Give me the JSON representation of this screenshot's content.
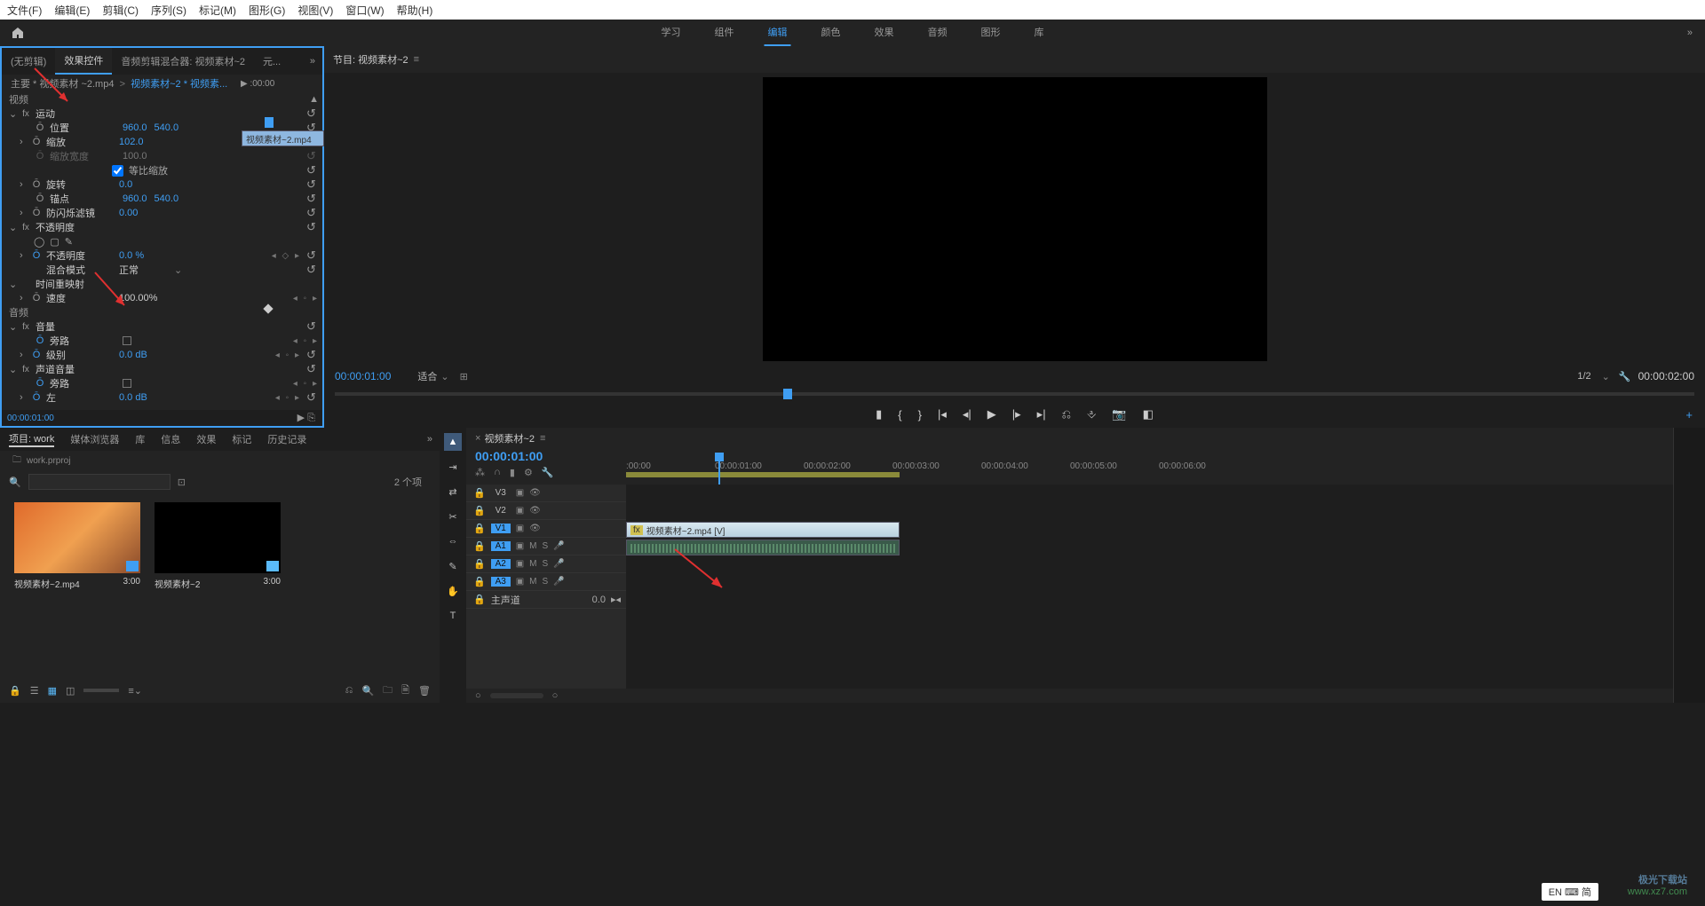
{
  "menubar": {
    "items": [
      "文件(F)",
      "编辑(E)",
      "剪辑(C)",
      "序列(S)",
      "标记(M)",
      "图形(G)",
      "视图(V)",
      "窗口(W)",
      "帮助(H)"
    ]
  },
  "workspace": {
    "tabs": [
      "学习",
      "组件",
      "编辑",
      "颜色",
      "效果",
      "音频",
      "图形",
      "库"
    ],
    "active_index": 2
  },
  "source_tabs": {
    "items": [
      "(无剪辑)",
      "效果控件",
      "音频剪辑混合器: 视频素材~2",
      "元..."
    ],
    "active_index": 1
  },
  "effect_header": {
    "master": "主要 * 视频素材 ~2.mp4",
    "sequence": "视频素材~2 * 视频素...",
    "time_start": ":00:00",
    "time_end": "00:00",
    "clip_label": "视频素材~2.mp4"
  },
  "effects": {
    "video_label": "视频",
    "motion": {
      "label": "运动",
      "position": {
        "label": "位置",
        "x": "960.0",
        "y": "540.0"
      },
      "scale": {
        "label": "缩放",
        "value": "102.0"
      },
      "scale_w": {
        "label": "缩放宽度",
        "value": "100.0"
      },
      "uniform": {
        "label": "等比缩放",
        "checked": true
      },
      "rotation": {
        "label": "旋转",
        "value": "0.0"
      },
      "anchor": {
        "label": "锚点",
        "x": "960.0",
        "y": "540.0"
      },
      "antiflicker": {
        "label": "防闪烁滤镜",
        "value": "0.00"
      }
    },
    "opacity": {
      "label": "不透明度",
      "value_label": "不透明度",
      "value": "0.0 %",
      "blend_label": "混合模式",
      "blend_value": "正常"
    },
    "timeremap": {
      "label": "时间重映射",
      "speed_label": "速度",
      "speed_value": "100.00%"
    },
    "audio_label": "音频",
    "volume": {
      "label": "音量",
      "bypass_label": "旁路",
      "level_label": "级别",
      "level_value": "0.0 dB"
    },
    "channel": {
      "label": "声道音量",
      "bypass_label": "旁路",
      "left_label": "左",
      "left_value": "0.0 dB"
    }
  },
  "source_tc": "00:00:01:00",
  "program": {
    "tab": "节目: 视频素材~2",
    "tc_left": "00:00:01:00",
    "fit": "适合",
    "scale": "1/2",
    "tc_right": "00:00:02:00"
  },
  "project": {
    "tabs": [
      "项目: work",
      "媒体浏览器",
      "库",
      "信息",
      "效果",
      "标记",
      "历史记录"
    ],
    "active_index": 0,
    "filename": "work.prproj",
    "search_placeholder": "",
    "count": "2 个项",
    "items": [
      {
        "name": "视频素材~2.mp4",
        "duration": "3:00"
      },
      {
        "name": "视频素材~2",
        "duration": "3:00"
      }
    ]
  },
  "tools": [
    "select",
    "track-select",
    "ripple",
    "razor",
    "slip",
    "pen",
    "hand",
    "type"
  ],
  "timeline": {
    "tab": "视频素材~2",
    "tc": "00:00:01:00",
    "ticks": [
      ":00:00",
      "00:00:01:00",
      "00:00:02:00",
      "00:00:03:00",
      "00:00:04:00",
      "00:00:05:00",
      "00:00:06:00"
    ],
    "clip_label": "视频素材~2.mp4 [V]",
    "tracks_v": [
      "V3",
      "V2",
      "V1"
    ],
    "tracks_a": [
      "A1",
      "A2",
      "A3"
    ],
    "master_label": "主声道",
    "master_value": "0.0"
  },
  "statusbar": {
    "ime": "EN ⌨ 简"
  },
  "watermark": {
    "line1": "极光下载站",
    "line2": "www.xz7.com"
  }
}
